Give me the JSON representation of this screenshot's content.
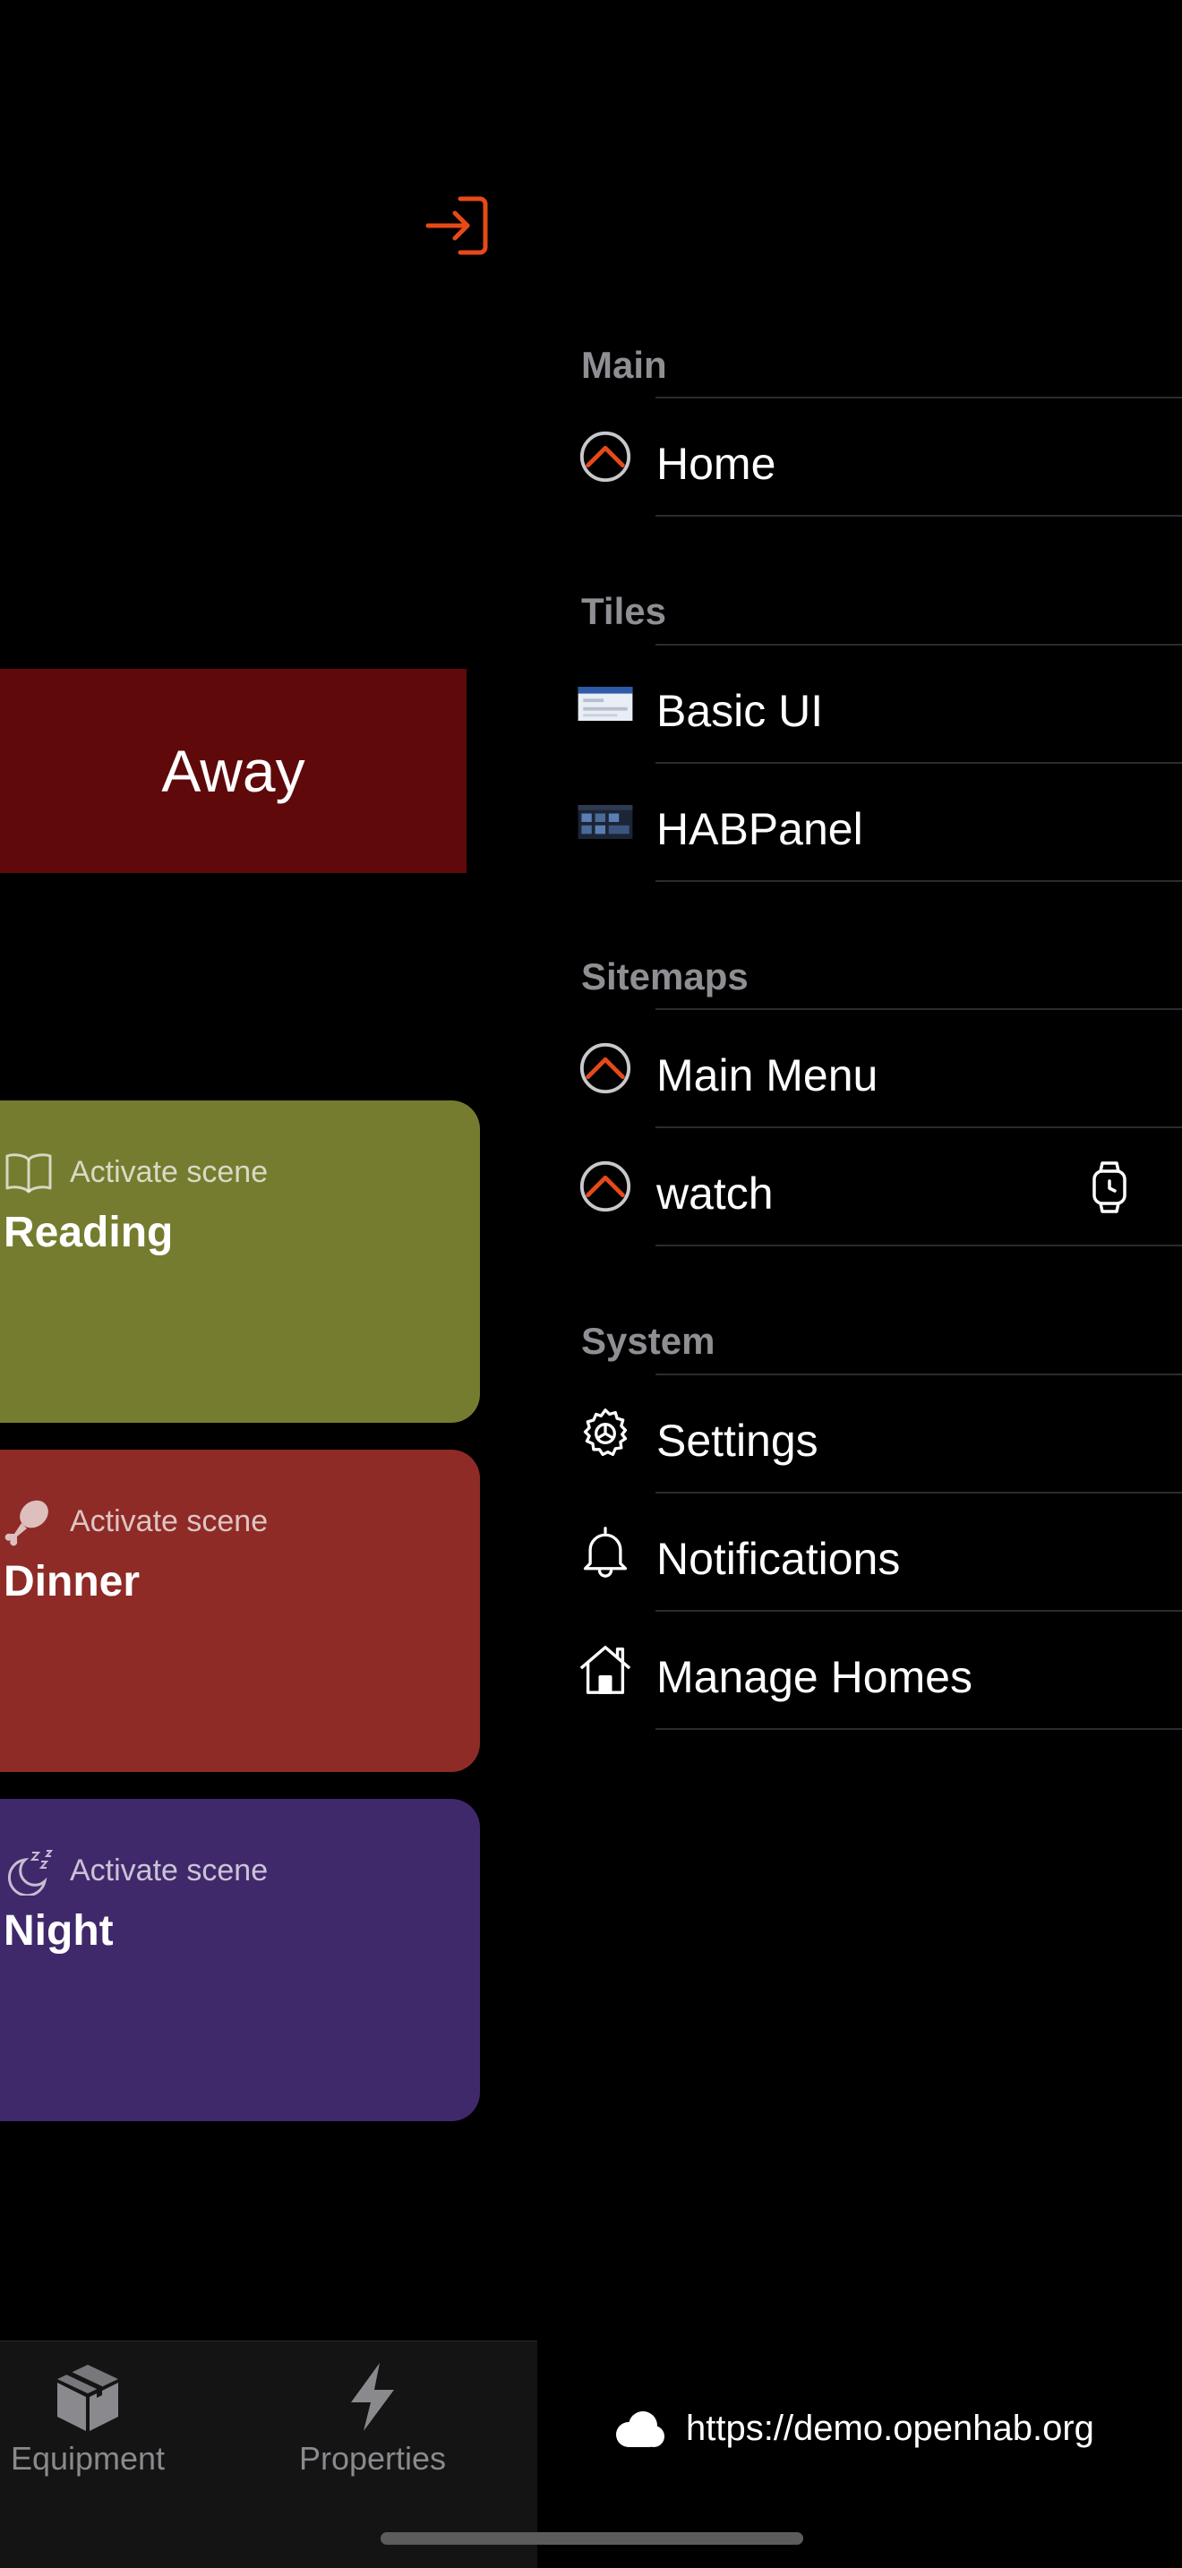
{
  "left": {
    "away_label": "Away",
    "scenes": [
      {
        "subtitle": "Activate scene",
        "title": "Reading",
        "icon": "book-icon",
        "color": "#757c2f"
      },
      {
        "subtitle": "Activate scene",
        "title": "Dinner",
        "icon": "drumstick-icon",
        "color": "#8e2b27"
      },
      {
        "subtitle": "Activate scene",
        "title": "Night",
        "icon": "moon-icon",
        "color": "#40296b"
      }
    ],
    "tabs": [
      {
        "label": "Equipment",
        "icon": "box-icon"
      },
      {
        "label": "Properties",
        "icon": "bolt-icon"
      }
    ]
  },
  "drawer": {
    "sections": [
      {
        "title": "Main",
        "items": [
          {
            "label": "Home",
            "icon": "openhab-logo-icon"
          }
        ]
      },
      {
        "title": "Tiles",
        "items": [
          {
            "label": "Basic UI",
            "icon": "basic-ui-thumbnail-icon"
          },
          {
            "label": "HABPanel",
            "icon": "habpanel-thumbnail-icon"
          }
        ]
      },
      {
        "title": "Sitemaps",
        "items": [
          {
            "label": "Main Menu",
            "icon": "openhab-logo-icon"
          },
          {
            "label": "watch",
            "icon": "openhab-logo-icon",
            "accessory": "watch-icon"
          }
        ]
      },
      {
        "title": "System",
        "items": [
          {
            "label": "Settings",
            "icon": "gear-icon"
          },
          {
            "label": "Notifications",
            "icon": "bell-icon"
          },
          {
            "label": "Manage Homes",
            "icon": "house-icon"
          }
        ]
      }
    ],
    "footer_url": "https://demo.openhab.org"
  },
  "colors": {
    "accent": "#e64a19",
    "away_tile": "#5f090b",
    "section_header": "#8e8e93",
    "separator": "#2c2c2e"
  }
}
